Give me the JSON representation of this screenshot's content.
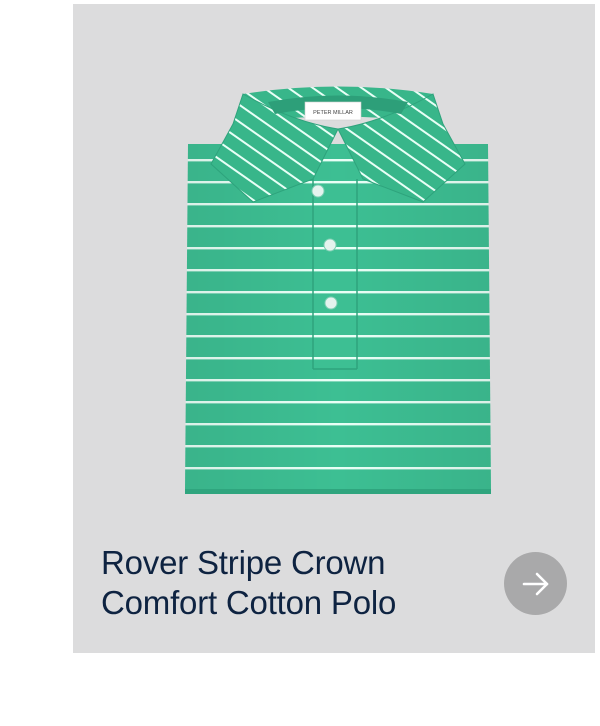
{
  "product": {
    "brand_tag": "PETER MILLAR",
    "title_line1": "Rover Stripe Crown",
    "title_line2": "Comfort Cotton Polo"
  },
  "colors": {
    "card_background": "#dcdcdd",
    "polo_green": "#3dbf93",
    "stripe": "#e8fff6",
    "title_text": "#0e2341",
    "arrow_button": "#a9a9aa"
  },
  "icons": {
    "next": "arrow-right-icon"
  }
}
